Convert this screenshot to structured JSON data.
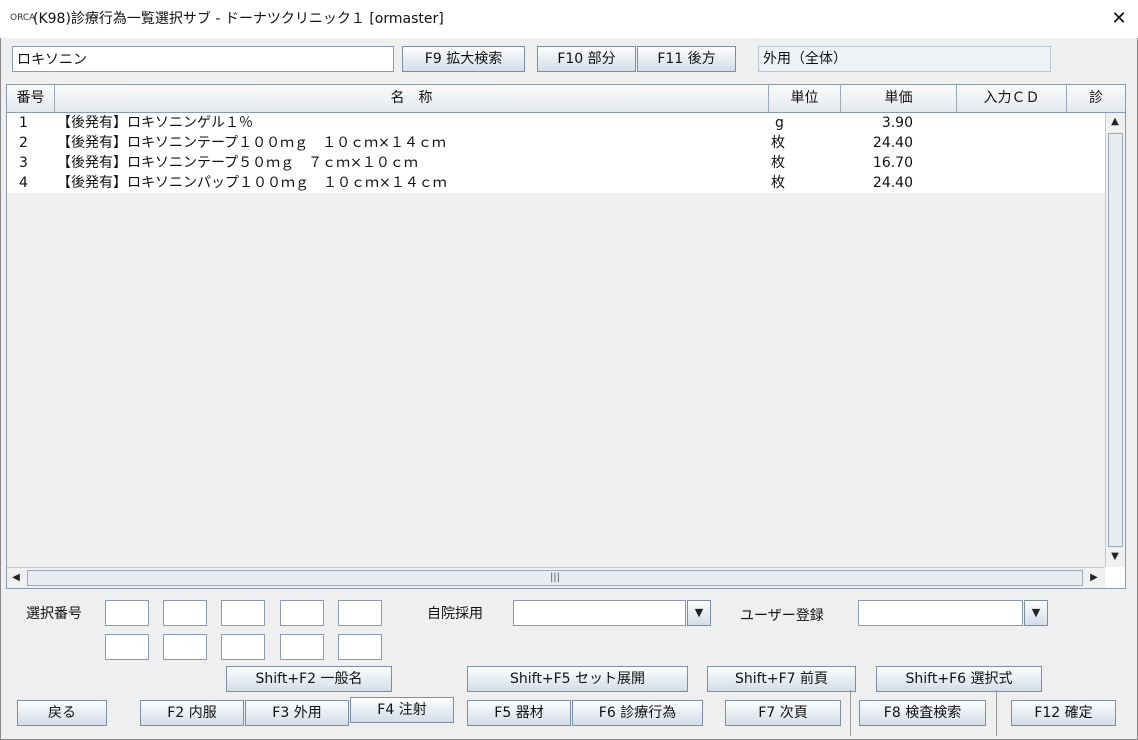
{
  "window": {
    "title": "(K98)診療行為一覧選択サブ - ドーナツクリニック１ [ormaster]",
    "app_icon": "ORCA",
    "close_glyph": "✕"
  },
  "search": {
    "value": "ロキソニン",
    "f9_label": "F9 拡大検索",
    "f10_label": "F10 部分",
    "f11_label": "F11 後方",
    "category_value": "外用（全体）"
  },
  "table": {
    "columns": [
      "番号",
      "名　称",
      "単位",
      "単価",
      "入力ＣＤ",
      "診"
    ],
    "rows": [
      {
        "no": "1",
        "name": "【後発有】ロキソニンゲル１％",
        "unit": "g",
        "price": "3.90",
        "code": "",
        "shin": ""
      },
      {
        "no": "2",
        "name": "【後発有】ロキソニンテープ１００ｍｇ　１０ｃｍ×１４ｃｍ",
        "unit": "枚",
        "price": "24.40",
        "code": "",
        "shin": ""
      },
      {
        "no": "3",
        "name": "【後発有】ロキソニンテープ５０ｍｇ　７ｃｍ×１０ｃｍ",
        "unit": "枚",
        "price": "16.70",
        "code": "",
        "shin": ""
      },
      {
        "no": "4",
        "name": "【後発有】ロキソニンパップ１００ｍｇ　１０ｃｍ×１４ｃｍ",
        "unit": "枚",
        "price": "24.40",
        "code": "",
        "shin": ""
      }
    ]
  },
  "scrollbar": {
    "up": "▲",
    "down": "▼",
    "left": "◀",
    "right": "▶",
    "grip": "|||"
  },
  "selection": {
    "label": "選択番号",
    "in_house_label": "自院採用",
    "user_reg_label": "ユーザー登録",
    "dropdown_glyph": "▼"
  },
  "buttons": {
    "shift_f2": "Shift+F2 一般名",
    "shift_f5": "Shift+F5 セット展開",
    "shift_f7": "Shift+F7 前頁",
    "shift_f6": "Shift+F6 選択式",
    "back": "戻る",
    "f2": "F2 内服",
    "f3": "F3 外用",
    "f4": "F4 注射",
    "f5": "F5 器材",
    "f6": "F6 診療行為",
    "f7": "F7 次頁",
    "f8": "F8 検査検索",
    "f12": "F12 確定"
  }
}
